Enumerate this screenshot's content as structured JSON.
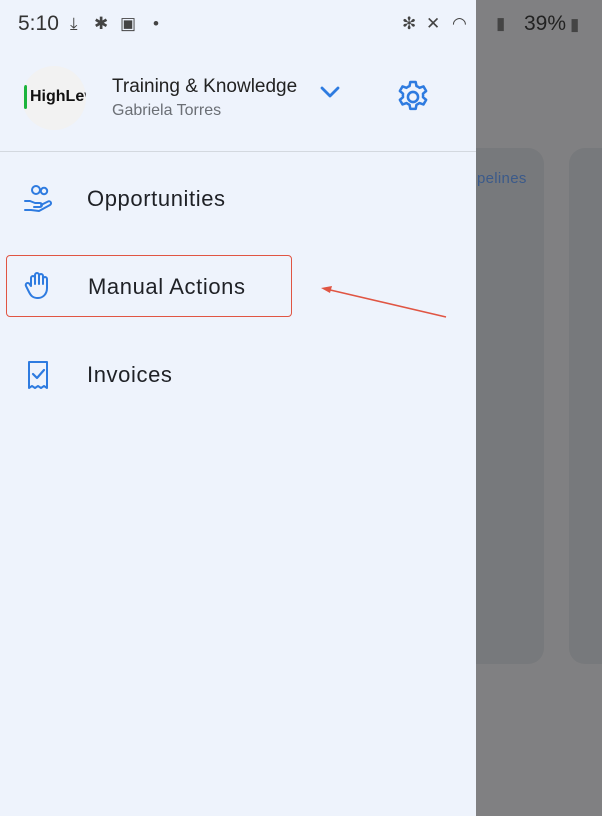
{
  "status_bar": {
    "time": "5:10",
    "battery": "39%",
    "icons_left": [
      "download-icon",
      "slack-icon",
      "image-icon",
      "dot-icon"
    ],
    "icons_right": [
      "bluetooth-icon",
      "mute-icon",
      "wifi-icon",
      "signal-icon",
      "battery-icon"
    ]
  },
  "drawer": {
    "logo_text": "HighLev",
    "account_name": "Training & Knowledge",
    "account_user": "Gabriela Torres",
    "menu": [
      {
        "label": "Opportunities",
        "icon": "hand-coins-icon"
      },
      {
        "label": "Manual Actions",
        "icon": "hand-icon",
        "highlighted": true
      },
      {
        "label": "Invoices",
        "icon": "receipt-icon"
      }
    ]
  },
  "background": {
    "pipelines_label": "pelines"
  },
  "colors": {
    "drawer_bg": "#eef3fc",
    "accent_blue": "#2e7be0",
    "highlight_red": "#e05543",
    "scrim": "#808082"
  }
}
